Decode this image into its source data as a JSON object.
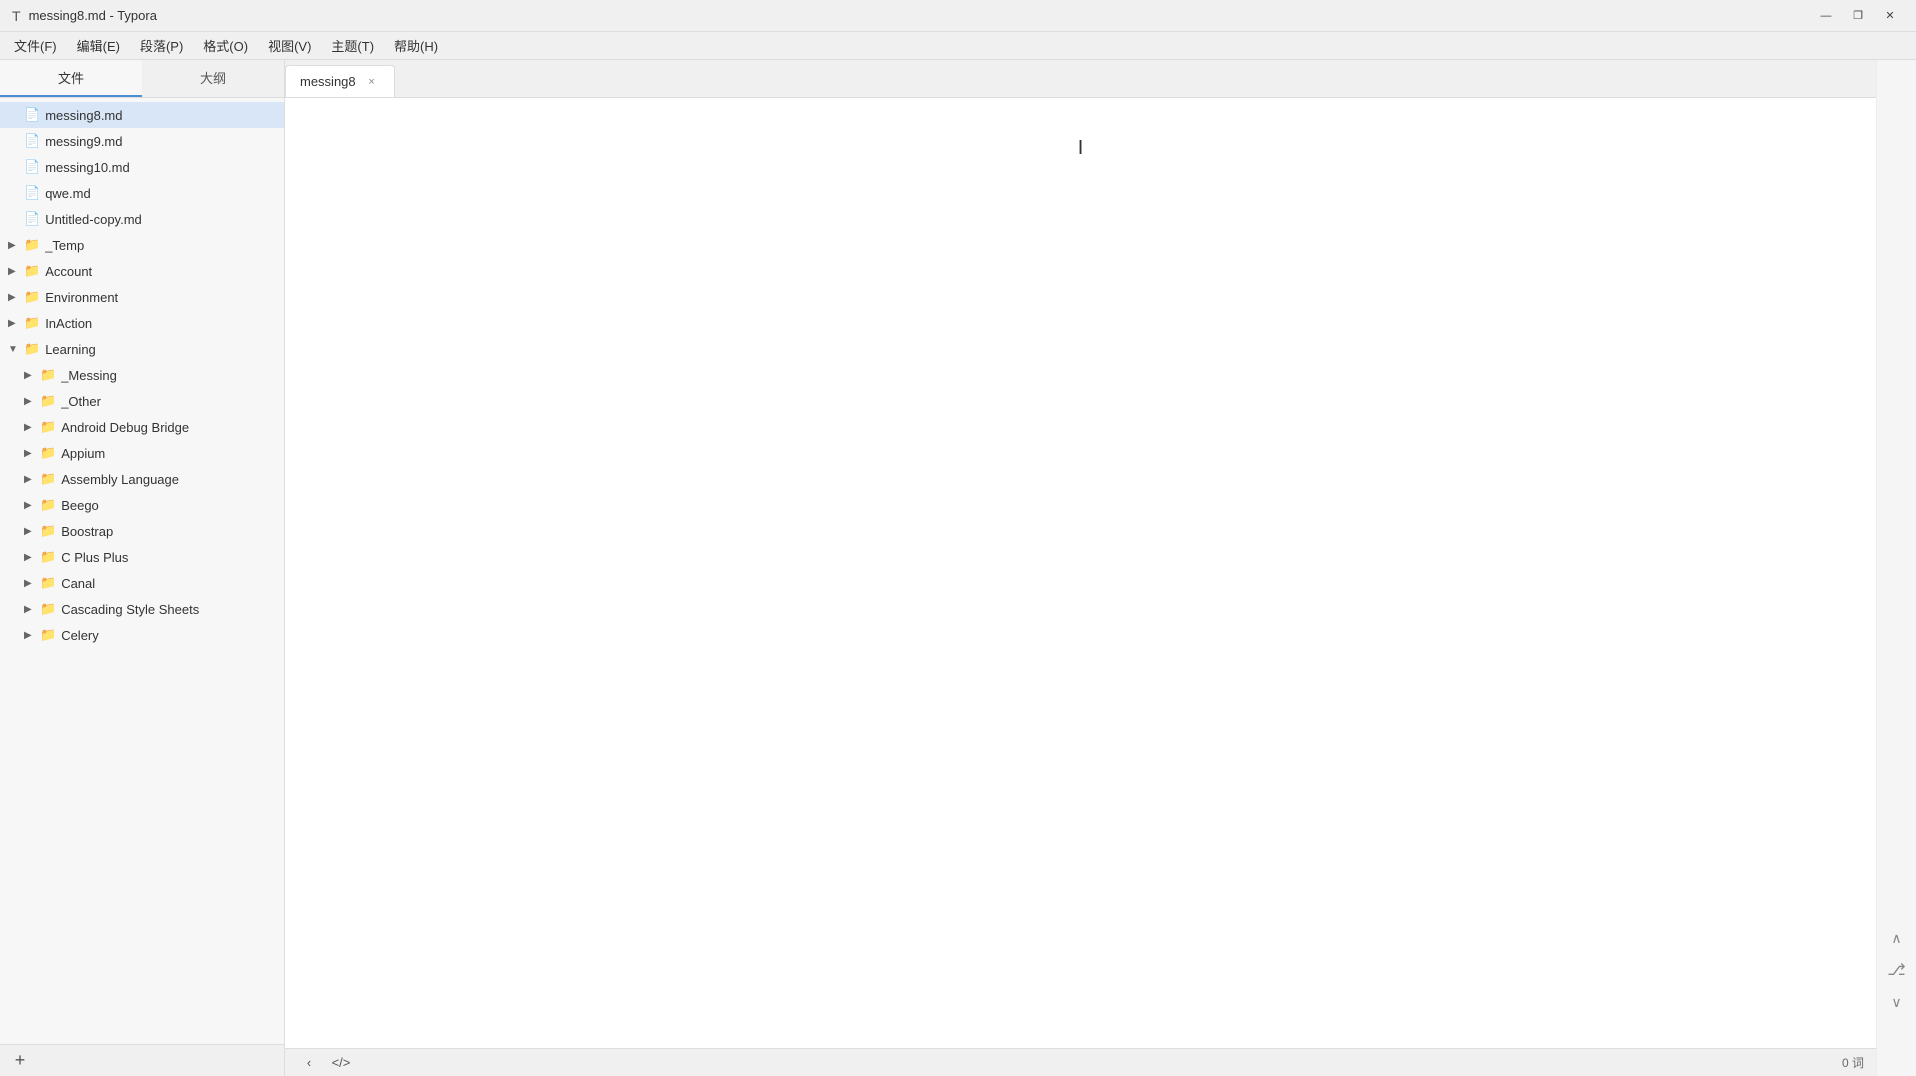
{
  "window": {
    "title": "messing8.md - Typora",
    "icon": "T"
  },
  "titlebar": {
    "minimize": "—",
    "maximize": "❐",
    "close": "✕"
  },
  "menubar": {
    "items": [
      {
        "id": "file",
        "label": "文件(F)"
      },
      {
        "id": "edit",
        "label": "编辑(E)"
      },
      {
        "id": "paragraph",
        "label": "段落(P)"
      },
      {
        "id": "format",
        "label": "格式(O)"
      },
      {
        "id": "view",
        "label": "视图(V)"
      },
      {
        "id": "theme",
        "label": "主题(T)"
      },
      {
        "id": "help",
        "label": "帮助(H)"
      }
    ]
  },
  "sidebar": {
    "tabs": [
      {
        "id": "files",
        "label": "文件",
        "active": true
      },
      {
        "id": "outline",
        "label": "大纲",
        "active": false
      }
    ],
    "tree": {
      "files": [
        {
          "id": "messing8",
          "label": "messing8.md",
          "type": "file",
          "indent": 0,
          "active": true
        },
        {
          "id": "messing9",
          "label": "messing9.md",
          "type": "file",
          "indent": 0,
          "active": false
        },
        {
          "id": "messing10",
          "label": "messing10.md",
          "type": "file",
          "indent": 0,
          "active": false
        },
        {
          "id": "qwe",
          "label": "qwe.md",
          "type": "file",
          "indent": 0,
          "active": false
        },
        {
          "id": "untitled-copy",
          "label": "Untitled-copy.md",
          "type": "file",
          "indent": 0,
          "active": false
        },
        {
          "id": "temp",
          "label": "_Temp",
          "type": "folder",
          "indent": 0,
          "collapsed": true
        },
        {
          "id": "account",
          "label": "Account",
          "type": "folder",
          "indent": 0,
          "collapsed": true
        },
        {
          "id": "environment",
          "label": "Environment",
          "type": "folder",
          "indent": 0,
          "collapsed": true
        },
        {
          "id": "inaction",
          "label": "InAction",
          "type": "folder",
          "indent": 0,
          "collapsed": true
        },
        {
          "id": "learning",
          "label": "Learning",
          "type": "folder",
          "indent": 0,
          "collapsed": false
        },
        {
          "id": "messing",
          "label": "_Messing",
          "type": "folder",
          "indent": 1,
          "collapsed": true
        },
        {
          "id": "other",
          "label": "_Other",
          "type": "folder",
          "indent": 1,
          "collapsed": true
        },
        {
          "id": "android-debug-bridge",
          "label": "Android Debug Bridge",
          "type": "folder",
          "indent": 1,
          "collapsed": true
        },
        {
          "id": "appium",
          "label": "Appium",
          "type": "folder",
          "indent": 1,
          "collapsed": true
        },
        {
          "id": "assembly-language",
          "label": "Assembly Language",
          "type": "folder",
          "indent": 1,
          "collapsed": true
        },
        {
          "id": "beego",
          "label": "Beego",
          "type": "folder",
          "indent": 1,
          "collapsed": true
        },
        {
          "id": "bootstrap",
          "label": "Boostrap",
          "type": "folder",
          "indent": 1,
          "collapsed": true
        },
        {
          "id": "c-plus-plus",
          "label": "C Plus Plus",
          "type": "folder",
          "indent": 1,
          "collapsed": true
        },
        {
          "id": "canal",
          "label": "Canal",
          "type": "folder",
          "indent": 1,
          "collapsed": true
        },
        {
          "id": "cascading-style-sheets",
          "label": "Cascading Style Sheets",
          "type": "folder",
          "indent": 1,
          "collapsed": true
        },
        {
          "id": "celery",
          "label": "Celery",
          "type": "folder",
          "indent": 1,
          "collapsed": true
        }
      ]
    },
    "add_btn": "+"
  },
  "tab": {
    "label": "messing8",
    "close": "×"
  },
  "editor": {
    "word_count_label": "0 词"
  },
  "bottom": {
    "nav_back": "‹",
    "nav_code": "</>",
    "scroll_up": "∧",
    "scroll_down": "∨",
    "version_icon": "⎇",
    "word_count": "0 词"
  }
}
